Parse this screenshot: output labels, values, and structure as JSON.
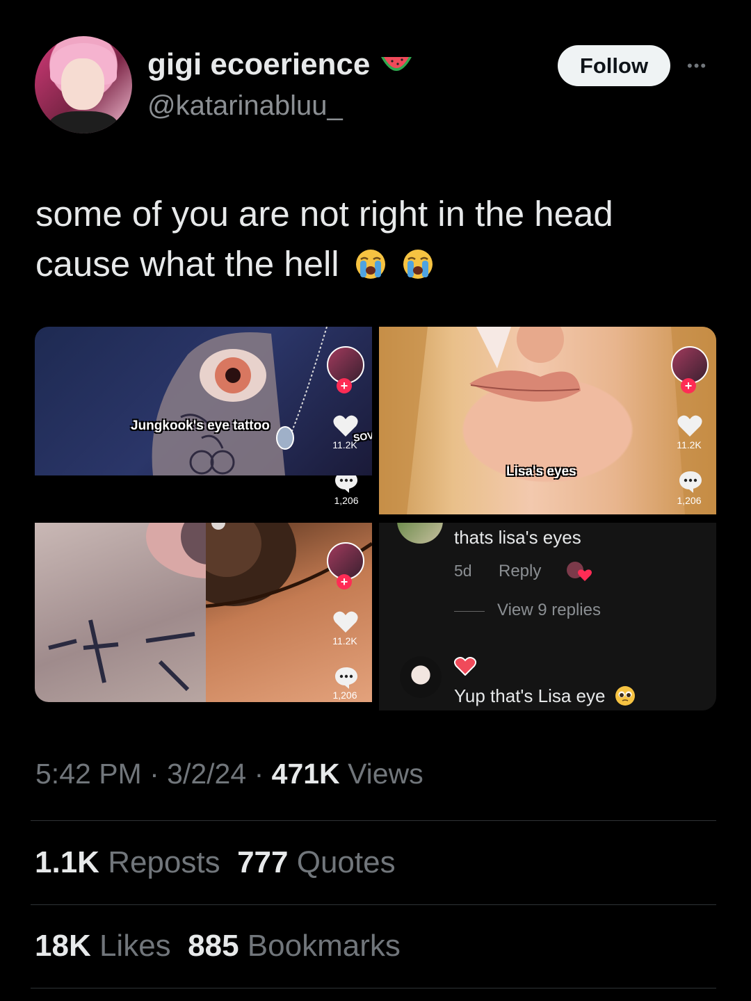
{
  "author": {
    "display_name": "gigi ecoerience",
    "handle": "@katarinabluu_",
    "name_emoji_icon": "watermelon-icon"
  },
  "actions": {
    "follow_label": "Follow",
    "more_icon": "more-icon"
  },
  "tweet": {
    "text_line1": "some of you are not right in the head",
    "text_line2": "cause what the hell",
    "emoji_icons": [
      "loudly-crying-face-icon",
      "loudly-crying-face-icon"
    ]
  },
  "media": {
    "top_left": {
      "caption": "Jungkook's eye tattoo",
      "likes": "11.2K",
      "comments": "1,206",
      "overlay_text": "SOV"
    },
    "top_right": {
      "caption": "Lisa's eyes",
      "likes": "11.2K",
      "comments": "1,206"
    },
    "bottom_left": {
      "likes": "11.2K",
      "comments": "1,206"
    },
    "comments_panel": {
      "comment1": {
        "text": "thats lisa's eyes",
        "age": "5d",
        "reply_label": "Reply",
        "view_replies": "View 9 replies"
      },
      "comment2": {
        "text": "Yup that's Lisa eye"
      }
    }
  },
  "meta": {
    "time": "5:42 PM",
    "date": "3/2/24",
    "views_count": "471K",
    "views_label": "Views",
    "sep": "·"
  },
  "stats": {
    "reposts_count": "1.1K",
    "reposts_label": "Reposts",
    "quotes_count": "777",
    "quotes_label": "Quotes",
    "likes_count": "18K",
    "likes_label": "Likes",
    "bookmarks_count": "885",
    "bookmarks_label": "Bookmarks"
  },
  "colors": {
    "background": "#000000",
    "text": "#e7e9ea",
    "muted": "#71767b",
    "accent_tiktok": "#fe2c55"
  }
}
